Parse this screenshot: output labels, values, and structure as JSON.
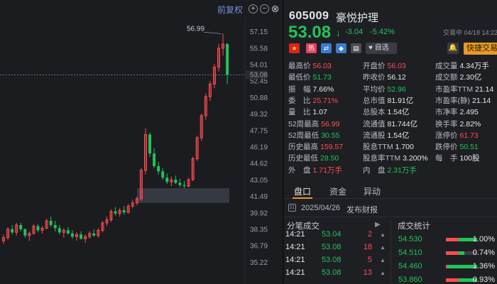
{
  "chart": {
    "fq_label": "前复权",
    "zoom_in": "+",
    "zoom_out": "−",
    "close": "⊗",
    "y_labels": [
      "57.15",
      "55.58",
      "54.01",
      "52.45",
      "50.88",
      "49.32",
      "47.75",
      "46.19",
      "44.62",
      "43.05",
      "41.49",
      "39.92",
      "38.35",
      "36.79",
      "35.22"
    ],
    "ymax": 57.15,
    "ymin": 35.22,
    "peak_label": "56.99",
    "current_price": "53.08",
    "up_color": "#ff4d4f",
    "down_color": "#22c35b",
    "candles": [
      [
        37.3,
        37.9,
        37.0,
        37.6
      ],
      [
        37.6,
        38.6,
        37.4,
        38.4
      ],
      [
        38.4,
        38.8,
        37.9,
        38.1
      ],
      [
        38.1,
        39.0,
        37.8,
        38.8
      ],
      [
        38.8,
        39.0,
        38.2,
        38.4
      ],
      [
        38.4,
        38.5,
        37.6,
        37.8
      ],
      [
        37.8,
        38.2,
        37.3,
        38.0
      ],
      [
        38.0,
        38.9,
        37.9,
        38.7
      ],
      [
        38.7,
        38.9,
        38.1,
        38.3
      ],
      [
        38.3,
        38.7,
        38.0,
        38.5
      ],
      [
        38.5,
        39.4,
        38.4,
        39.2
      ],
      [
        39.2,
        39.6,
        38.6,
        38.8
      ],
      [
        38.8,
        39.2,
        38.2,
        38.5
      ],
      [
        38.5,
        38.8,
        37.9,
        38.1
      ],
      [
        38.1,
        38.5,
        37.6,
        38.3
      ],
      [
        38.3,
        38.6,
        37.9,
        38.0
      ],
      [
        38.0,
        38.3,
        37.5,
        37.7
      ],
      [
        37.7,
        38.1,
        37.3,
        37.9
      ],
      [
        37.9,
        38.2,
        37.4,
        37.5
      ],
      [
        37.5,
        37.9,
        37.1,
        37.7
      ],
      [
        37.7,
        38.2,
        37.5,
        38.0
      ],
      [
        38.0,
        38.4,
        37.7,
        37.8
      ],
      [
        37.8,
        38.5,
        37.6,
        38.3
      ],
      [
        38.3,
        39.2,
        38.1,
        39.0
      ],
      [
        39.0,
        39.6,
        38.7,
        39.3
      ],
      [
        39.3,
        40.3,
        39.1,
        40.1
      ],
      [
        40.1,
        40.5,
        39.7,
        39.9
      ],
      [
        39.9,
        40.4,
        39.6,
        40.2
      ],
      [
        40.2,
        40.6,
        39.8,
        40.0
      ],
      [
        40.0,
        40.8,
        39.9,
        40.6
      ],
      [
        40.6,
        41.2,
        40.4,
        40.9
      ],
      [
        40.9,
        41.5,
        40.7,
        41.3
      ],
      [
        41.3,
        44.2,
        41.1,
        44.0
      ],
      [
        44.0,
        48.0,
        43.6,
        47.4
      ],
      [
        47.4,
        47.6,
        45.3,
        45.6
      ],
      [
        45.6,
        46.1,
        44.2,
        44.4
      ],
      [
        44.4,
        44.8,
        43.6,
        43.9
      ],
      [
        43.9,
        44.2,
        43.1,
        43.3
      ],
      [
        43.3,
        43.7,
        42.7,
        42.9
      ],
      [
        42.9,
        43.4,
        42.5,
        43.1
      ],
      [
        43.1,
        43.5,
        42.7,
        42.8
      ],
      [
        42.8,
        43.2,
        42.4,
        42.6
      ],
      [
        42.6,
        43.0,
        42.3,
        42.5
      ],
      [
        42.5,
        43.3,
        42.4,
        43.1
      ],
      [
        43.1,
        45.3,
        43.0,
        45.1
      ],
      [
        45.1,
        47.3,
        44.9,
        47.1
      ],
      [
        47.1,
        49.4,
        46.8,
        49.2
      ],
      [
        49.2,
        51.3,
        48.8,
        51.0
      ],
      [
        51.0,
        52.5,
        50.6,
        52.2
      ],
      [
        52.2,
        54.1,
        51.8,
        53.8
      ],
      [
        53.8,
        56.0,
        53.4,
        55.6
      ],
      [
        55.6,
        56.99,
        54.9,
        56.0
      ],
      [
        56.0,
        56.1,
        52.2,
        53.08
      ]
    ]
  },
  "quote": {
    "code": "605009",
    "name": "豪悦护理",
    "price": "53.08",
    "arrow": "↓",
    "change": "-3.04",
    "change_pct": "-5.42%",
    "trade_time": "交易中 04/18 14:22"
  },
  "badges": {
    "flag": "★",
    "hot": "热",
    "link": "⇄",
    "tag": "◆",
    "note": "▤",
    "watch_label": "♥ 自选",
    "bell": "🔔",
    "quick_trade": "快捷交易"
  },
  "stats": [
    [
      {
        "label": "最高价",
        "value": "56.03",
        "color": "red"
      },
      {
        "label": "开盘价",
        "value": "56.03",
        "color": "red"
      },
      {
        "label": "成交量",
        "value": "4.34万手",
        "color": "white"
      }
    ],
    [
      {
        "label": "最低价",
        "value": "51.73",
        "color": "green"
      },
      {
        "label": "昨收价",
        "value": "56.12",
        "color": "white"
      },
      {
        "label": "成交额",
        "value": "2.30亿",
        "color": "white"
      }
    ],
    [
      {
        "label": "振　幅",
        "value": "7.66%",
        "color": "white"
      },
      {
        "label": "平均价",
        "value": "52.96",
        "color": "green"
      },
      {
        "label": "市盈率TTM",
        "value": "21.14",
        "color": "white"
      }
    ],
    [
      {
        "label": "委　比",
        "value": "25.71%",
        "color": "red"
      },
      {
        "label": "总市值",
        "value": "81.91亿",
        "color": "white"
      },
      {
        "label": "市盈率(静)",
        "value": "21.14",
        "color": "white"
      }
    ],
    [
      {
        "label": "量　比",
        "value": "1.07",
        "color": "white"
      },
      {
        "label": "总股本",
        "value": "1.54亿",
        "color": "white"
      },
      {
        "label": "市净率",
        "value": "2.495",
        "color": "white"
      }
    ],
    [
      {
        "label": "52周最高",
        "value": "56.99",
        "color": "red"
      },
      {
        "label": "流通值",
        "value": "81.744亿",
        "color": "white"
      },
      {
        "label": "换手率",
        "value": "2.82%",
        "color": "white"
      }
    ],
    [
      {
        "label": "52周最低",
        "value": "30.55",
        "color": "green"
      },
      {
        "label": "流通股",
        "value": "1.54亿",
        "color": "white"
      },
      {
        "label": "涨停价",
        "value": "61.73",
        "color": "red"
      }
    ],
    [
      {
        "label": "历史最高",
        "value": "159.57",
        "color": "red"
      },
      {
        "label": "股息TTM",
        "value": "1.700",
        "color": "white"
      },
      {
        "label": "跌停价",
        "value": "50.51",
        "color": "green"
      }
    ],
    [
      {
        "label": "历史最低",
        "value": "28.50",
        "color": "green"
      },
      {
        "label": "股息率TTM",
        "value": "3.200%",
        "color": "white"
      },
      {
        "label": "每　手",
        "value": "100股",
        "color": "white"
      }
    ],
    [
      {
        "label": "外　盘",
        "value": "1.71万手",
        "color": "red"
      },
      {
        "label": "内　盘",
        "value": "2.31万手",
        "color": "green"
      }
    ]
  ],
  "tabs": {
    "pankou": "盘口",
    "zijin": "资金",
    "yidong": "异动"
  },
  "announcement": {
    "icon": "31",
    "date": "2025/04/26",
    "text": "发布财报"
  },
  "trades": {
    "header": "分笔成交",
    "more": "▶",
    "rows": [
      {
        "time": "14:21",
        "price": "53.04",
        "vol": "2",
        "color": "red",
        "dir": "▲"
      },
      {
        "time": "14:21",
        "price": "53.08",
        "vol": "18",
        "color": "red",
        "dir": "▲"
      },
      {
        "time": "14:21",
        "price": "53.08",
        "vol": "5",
        "color": "red",
        "dir": "▲"
      },
      {
        "time": "14:21",
        "price": "53.08",
        "vol": "13",
        "color": "red",
        "dir": "▲"
      }
    ]
  },
  "distribution": {
    "header": "成交统计",
    "rows": [
      {
        "price": "54.530",
        "red": 0.4,
        "green": 0.6,
        "pct": "1.00%"
      },
      {
        "price": "54.510",
        "red": 0.4,
        "green": 0.2,
        "pct": "0.74%"
      },
      {
        "price": "54.460",
        "red": 0.05,
        "green": 0.95,
        "pct": "1.36%"
      },
      {
        "price": "53.860",
        "red": 0.4,
        "green": 0.6,
        "pct": "0.93%"
      }
    ]
  }
}
